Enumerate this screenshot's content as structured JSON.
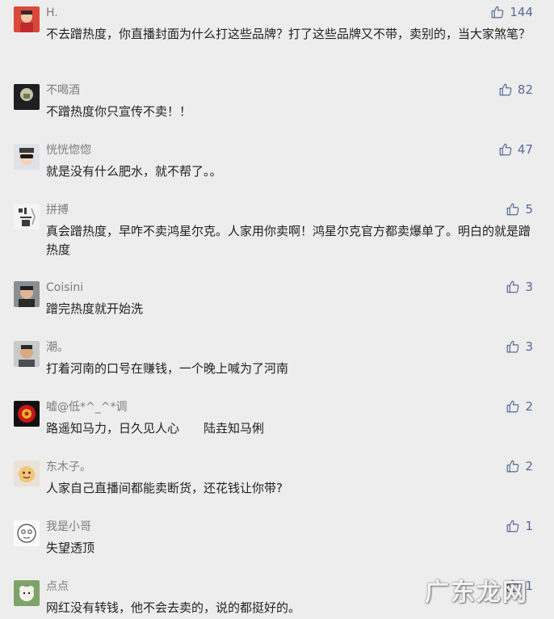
{
  "comments": [
    {
      "nickname": "H.",
      "text": "不去蹭热度，你直播封面为什么打这些品牌？打了这些品牌又不带，卖别的，当大家煞笔？",
      "likes": "144"
    },
    {
      "nickname": "不喝酒",
      "text": "不蹭热度你只宣传不卖！！",
      "likes": "82"
    },
    {
      "nickname": "恍恍惚惚",
      "text": "就是没有什么肥水，就不帮了。。",
      "likes": "47"
    },
    {
      "nickname": "拼搏",
      "text": "真会蹭热度，早咋不卖鸿星尔克。人家用你卖啊！鸿星尔克官方都卖爆单了。明白的就是蹭热度",
      "likes": "5"
    },
    {
      "nickname": "Coisini",
      "text": "蹭完热度就开始洗",
      "likes": "3"
    },
    {
      "nickname": "潮。",
      "text": "打着河南的口号在赚钱，一个晚上喊为了河南",
      "likes": "3"
    },
    {
      "nickname": "嘘@低*^_^*调",
      "text": "路遥知马力，日久见人心　　陆垚知马俐",
      "likes": "2"
    },
    {
      "nickname": "东木子。",
      "text": "人家自己直播间都能卖断货，还花钱让你带?",
      "likes": "2"
    },
    {
      "nickname": "我是小哥",
      "text": "失望透顶",
      "likes": "1"
    },
    {
      "nickname": "点点",
      "text": "网红没有转钱，他不会去卖的，说的都挺好的。",
      "likes": "1"
    }
  ],
  "watermark": "广东龙网",
  "colors": {
    "background": "#ededed",
    "link": "#576b95",
    "nickname": "#7d7d7d",
    "text": "#222222"
  },
  "icons": {
    "like": "thumbs-up-icon"
  }
}
